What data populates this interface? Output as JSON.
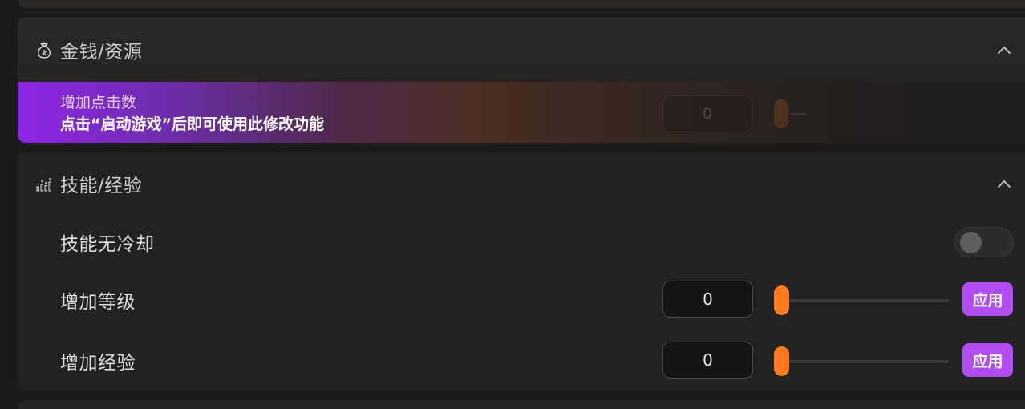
{
  "money_section": {
    "title": "金钱/资源",
    "icon": "money-bag-icon",
    "banner": {
      "title": "增加点击数",
      "message": "点击“启动游戏”后即可使用此修改功能",
      "input_value": "0"
    }
  },
  "skill_section": {
    "title": "技能/经验",
    "icon": "bar-chart-icon",
    "cooldown": {
      "label": "技能无冷却",
      "enabled": false
    },
    "level": {
      "label": "增加等级",
      "value": "0",
      "slider_fraction": 0,
      "apply_label": "应用"
    },
    "exp": {
      "label": "增加经验",
      "value": "0",
      "slider_fraction": 0,
      "apply_label": "应用"
    }
  },
  "colors": {
    "accent_orange": "#ff7a1f",
    "accent_purple": "#b14df0",
    "banner_purple": "#8e25e6"
  }
}
